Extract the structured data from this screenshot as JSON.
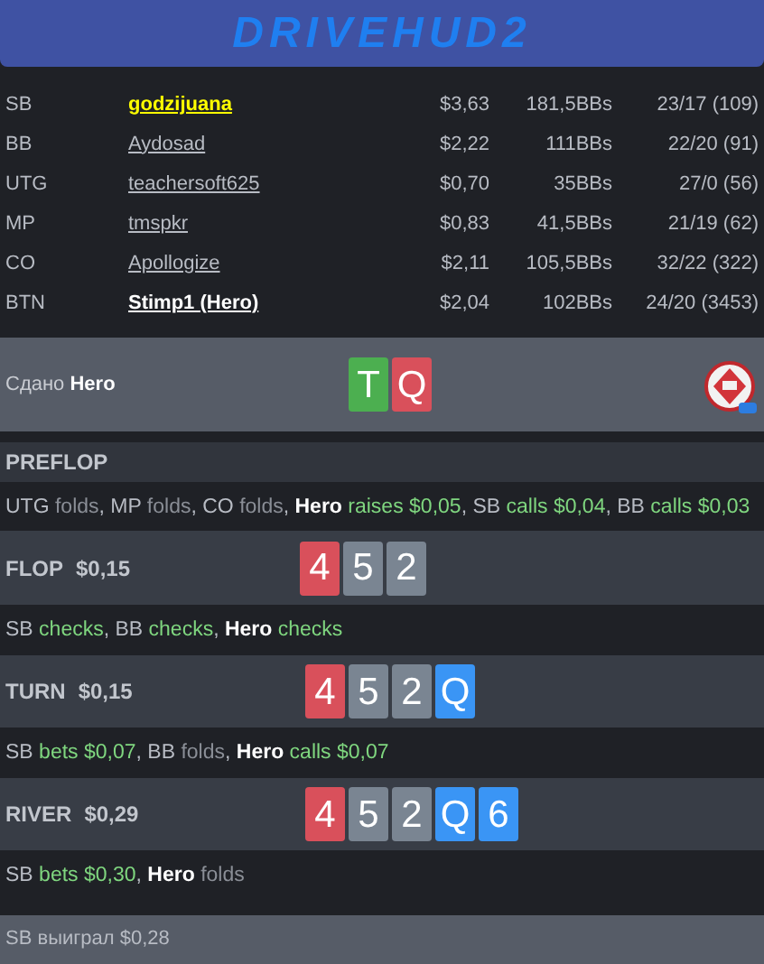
{
  "header": {
    "logo": "DRIVEHUD2"
  },
  "players": [
    {
      "position": "SB",
      "name": "godzijuana",
      "kind": "marked",
      "stack": "$3,63",
      "bbs": "181,5BBs",
      "stats": "23/17 (109)"
    },
    {
      "position": "BB",
      "name": "Aydosad",
      "kind": "regular",
      "stack": "$2,22",
      "bbs": "111BBs",
      "stats": "22/20 (91)"
    },
    {
      "position": "UTG",
      "name": "teachersoft625",
      "kind": "regular",
      "stack": "$0,70",
      "bbs": "35BBs",
      "stats": "27/0 (56)"
    },
    {
      "position": "MP",
      "name": "tmspkr",
      "kind": "regular",
      "stack": "$0,83",
      "bbs": "41,5BBs",
      "stats": "21/19 (62)"
    },
    {
      "position": "CO",
      "name": "Apollogize",
      "kind": "regular",
      "stack": "$2,11",
      "bbs": "105,5BBs",
      "stats": "32/22 (322)"
    },
    {
      "position": "BTN",
      "name": "Stimp1 (Hero)",
      "kind": "hero",
      "stack": "$2,04",
      "bbs": "102BBs",
      "stats": "24/20 (3453)"
    }
  ],
  "dealt": {
    "label": "Сдано",
    "hero": "Hero",
    "cards": [
      {
        "rank": "T",
        "color": "#4caf50"
      },
      {
        "rank": "Q",
        "color": "#d9505b"
      }
    ]
  },
  "streets": [
    {
      "name": "PREFLOP",
      "actions": [
        {
          "player": "UTG",
          "hero": false,
          "action": "folds",
          "kind": "fold",
          "sep": ", "
        },
        {
          "player": "MP",
          "hero": false,
          "action": "folds",
          "kind": "fold",
          "sep": ", "
        },
        {
          "player": "CO",
          "hero": false,
          "action": "folds",
          "kind": "fold",
          "sep": ", "
        },
        {
          "player": "Hero",
          "hero": true,
          "action": "raises $0,05",
          "kind": "active",
          "sep": ", "
        },
        {
          "player": "SB",
          "hero": false,
          "action": "calls $0,04",
          "kind": "active",
          "sep": ", "
        },
        {
          "player": "BB",
          "hero": false,
          "action": "calls $0,03",
          "kind": "active"
        }
      ]
    },
    {
      "name": "FLOP",
      "pot": "$0,15",
      "cards": [
        {
          "rank": "4",
          "color": "#d9505b"
        },
        {
          "rank": "5",
          "color": "#7a8592"
        },
        {
          "rank": "2",
          "color": "#7a8592"
        }
      ],
      "actions": [
        {
          "player": "SB",
          "hero": false,
          "action": "checks",
          "kind": "active",
          "sep": ", "
        },
        {
          "player": "BB",
          "hero": false,
          "action": "checks",
          "kind": "active",
          "sep": ", "
        },
        {
          "player": "Hero",
          "hero": true,
          "action": "checks",
          "kind": "active"
        }
      ]
    },
    {
      "name": "TURN",
      "pot": "$0,15",
      "cards": [
        {
          "rank": "4",
          "color": "#d9505b"
        },
        {
          "rank": "5",
          "color": "#7a8592"
        },
        {
          "rank": "2",
          "color": "#7a8592"
        },
        {
          "rank": "Q",
          "color": "#3a95f5"
        }
      ],
      "actions": [
        {
          "player": "SB",
          "hero": false,
          "action": "bets $0,07",
          "kind": "active",
          "sep": ", "
        },
        {
          "player": "BB",
          "hero": false,
          "action": "folds",
          "kind": "fold",
          "sep": ", "
        },
        {
          "player": "Hero",
          "hero": true,
          "action": "calls $0,07",
          "kind": "active"
        }
      ]
    },
    {
      "name": "RIVER",
      "pot": "$0,29",
      "cards": [
        {
          "rank": "4",
          "color": "#d9505b"
        },
        {
          "rank": "5",
          "color": "#7a8592"
        },
        {
          "rank": "2",
          "color": "#7a8592"
        },
        {
          "rank": "Q",
          "color": "#3a95f5"
        },
        {
          "rank": "6",
          "color": "#3a95f5"
        }
      ],
      "actions": [
        {
          "player": "SB",
          "hero": false,
          "action": "bets $0,30",
          "kind": "active",
          "sep": ", "
        },
        {
          "player": "Hero",
          "hero": true,
          "action": "folds",
          "kind": "fold"
        }
      ]
    }
  ],
  "result": "SB выиграл $0,28"
}
